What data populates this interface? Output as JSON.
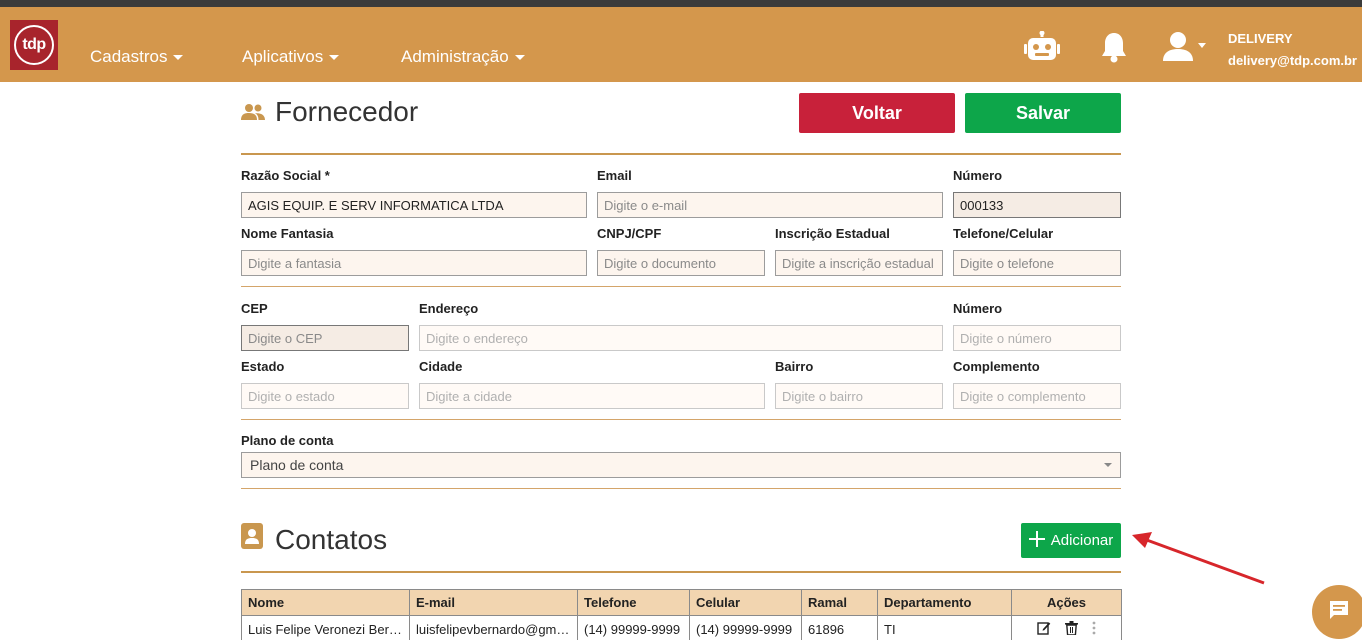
{
  "header": {
    "logo_text": "tdp",
    "menu": [
      {
        "label": "Cadastros"
      },
      {
        "label": "Aplicativos"
      },
      {
        "label": "Administração"
      }
    ],
    "user": {
      "name": "DELIVERY",
      "email": "delivery@tdp.com.br"
    }
  },
  "page": {
    "title": "Fornecedor",
    "voltar_label": "Voltar",
    "salvar_label": "Salvar"
  },
  "form": {
    "razao_social": {
      "label": "Razão Social *",
      "value": "AGIS EQUIP. E SERV INFORMATICA LTDA"
    },
    "email": {
      "label": "Email",
      "placeholder": "Digite o e-mail"
    },
    "numero_id": {
      "label": "Número",
      "value": "000133"
    },
    "nome_fantasia": {
      "label": "Nome Fantasia",
      "placeholder": "Digite a fantasia"
    },
    "cnpj": {
      "label": "CNPJ/CPF",
      "placeholder": "Digite o documento"
    },
    "inscricao": {
      "label": "Inscrição Estadual",
      "placeholder": "Digite a inscrição estadual"
    },
    "telefone": {
      "label": "Telefone/Celular",
      "placeholder": "Digite o telefone"
    },
    "cep": {
      "label": "CEP",
      "placeholder": "Digite o CEP"
    },
    "endereco": {
      "label": "Endereço",
      "placeholder": "Digite o endereço"
    },
    "numero_end": {
      "label": "Número",
      "placeholder": "Digite o número"
    },
    "estado": {
      "label": "Estado",
      "placeholder": "Digite o estado"
    },
    "cidade": {
      "label": "Cidade",
      "placeholder": "Digite a cidade"
    },
    "bairro": {
      "label": "Bairro",
      "placeholder": "Digite o bairro"
    },
    "complemento": {
      "label": "Complemento",
      "placeholder": "Digite o complemento"
    },
    "plano_conta": {
      "label": "Plano de conta",
      "selected": "Plano de conta"
    }
  },
  "contatos": {
    "title": "Contatos",
    "add_label": "Adicionar",
    "columns": [
      "Nome",
      "E-mail",
      "Telefone",
      "Celular",
      "Ramal",
      "Departamento",
      "Ações"
    ],
    "rows": [
      {
        "nome": "Luis Felipe Veronezi Bernardo",
        "email": "luisfelipevbernardo@gmail.com",
        "telefone": "(14) 99999-9999",
        "celular": "(14) 99999-9999",
        "ramal": "61896",
        "departamento": "TI"
      }
    ]
  },
  "colors": {
    "navbar": "#d4974c",
    "voltar": "#c8213a",
    "salvar": "#0da64a",
    "logo_bg": "#a8242c",
    "table_header": "#f2d5b0",
    "annotation_arrow": "#d7262b"
  }
}
